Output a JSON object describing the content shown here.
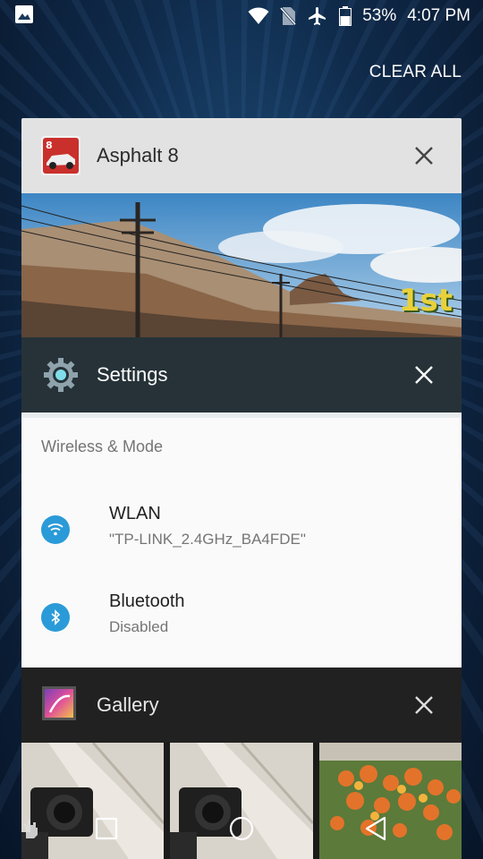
{
  "status_bar": {
    "battery": "53%",
    "time": "4:07 PM",
    "icons": [
      "image-notification-icon",
      "wifi-icon",
      "no-sim-icon",
      "airplane-mode-icon",
      "battery-icon"
    ]
  },
  "clear_all_label": "CLEAR ALL",
  "recents": [
    {
      "app": "Asphalt 8",
      "icon": "asphalt-8-app-icon",
      "preview": {
        "badge": "1st"
      }
    },
    {
      "app": "Settings",
      "icon": "settings-gear-icon",
      "preview": {
        "section_title": "Wireless & Mode",
        "items": [
          {
            "title": "WLAN",
            "summary": "\"TP-LINK_2.4GHz_BA4FDE\"",
            "icon": "wifi-icon"
          },
          {
            "title": "Bluetooth",
            "summary": "Disabled",
            "icon": "bluetooth-icon"
          }
        ]
      }
    },
    {
      "app": "Gallery",
      "icon": "gallery-app-icon",
      "preview": {
        "thumbnails": [
          "camera-photo",
          "camera-photo",
          "flowers-photo"
        ]
      }
    }
  ],
  "nav_bar": {
    "buttons": [
      "recents-button",
      "home-button",
      "back-button"
    ]
  },
  "colors": {
    "background": "#0f2a4a",
    "asphalt_header": "#e2e2e2",
    "settings_header": "#263238",
    "gallery_header": "#212121",
    "accent_blue": "#2a9bd8"
  }
}
